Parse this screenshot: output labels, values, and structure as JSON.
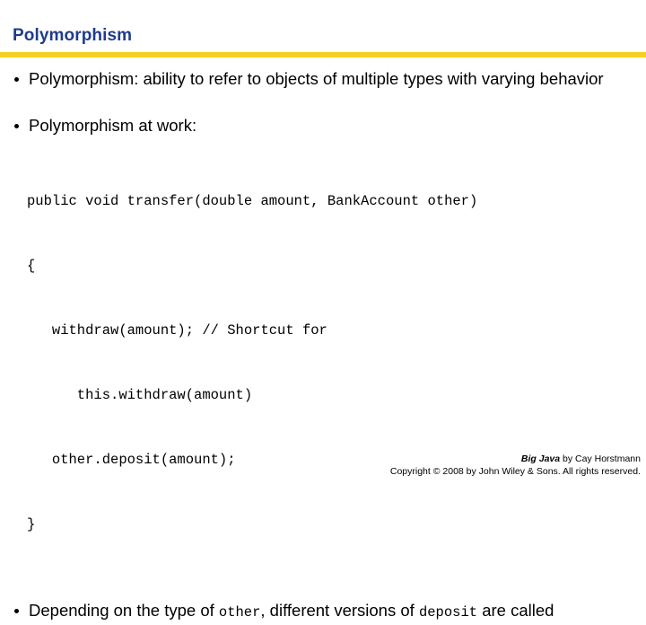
{
  "slide": {
    "title": "Polymorphism",
    "accent_title_color": "#1F3C8C",
    "accent_rule_color": "#F5D020"
  },
  "bullets": {
    "first": "Polymorphism: ability to refer to objects of multiple types with varying behavior",
    "second": "Polymorphism at work:",
    "third": {
      "part1": "Depending on the type of ",
      "code1": "other",
      "part2": ", different versions of ",
      "code2": "deposit",
      "part3": " are called"
    }
  },
  "code": {
    "lines": [
      "public void transfer(double amount, BankAccount other)",
      "{",
      "   withdraw(amount); // Shortcut for",
      "      this.withdraw(amount)",
      "   other.deposit(amount);",
      "}"
    ]
  },
  "footer": {
    "book_title": "Big Java",
    "attribution": " by Cay Horstmann",
    "copyright": "Copyright © 2008 by John Wiley & Sons.  All rights reserved."
  }
}
